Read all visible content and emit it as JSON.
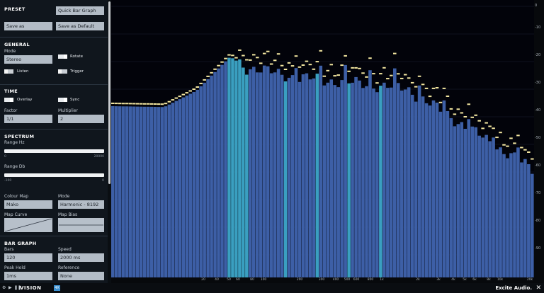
{
  "preset": {
    "title": "PRESET",
    "selected": "Quick Bar Graph",
    "save_as": "Save as",
    "save_default": "Save as Default"
  },
  "general": {
    "title": "GENERAL",
    "mode_label": "Mode",
    "mode_value": "Stereo",
    "rotate": "Rotate",
    "listen": "Listen",
    "trigger": "Trigger"
  },
  "time": {
    "title": "TIME",
    "overlay": "Overlay",
    "sync": "Sync",
    "factor_label": "Factor",
    "factor_value": "1/1",
    "multiplier_label": "Multiplier",
    "multiplier_value": "2"
  },
  "spectrum": {
    "title": "SPECTRUM",
    "range_hz_label": "Range Hz",
    "range_hz_min": "0",
    "range_hz_max": "20000",
    "range_db_label": "Range Db",
    "range_db_min": "-100",
    "range_db_max": "0",
    "colour_map_label": "Colour Map",
    "colour_map_value": "Mako",
    "mode_label": "Mode",
    "mode_value": "Harmonic - 8192",
    "map_curve_label": "Map Curve",
    "map_bias_label": "Map Bias"
  },
  "bar_graph": {
    "title": "BAR GRAPH",
    "bars_label": "Bars",
    "bars_value": "120",
    "speed_label": "Speed",
    "speed_value": "2000 ms",
    "peak_hold_label": "Peak Hold",
    "peak_hold_value": "1ms",
    "reference_label": "Reference",
    "reference_value": "None"
  },
  "plot": {
    "y_ticks": [
      "0",
      "-10",
      "-20",
      "-30",
      "-40",
      "-50",
      "-60",
      "-70",
      "-80",
      "-90"
    ],
    "x_ticks": [
      "20",
      "40",
      "50",
      "60",
      "80",
      "100",
      "200",
      "300",
      "400",
      "500",
      "600",
      "800",
      "1k",
      "2k",
      "3k",
      "4k",
      "5k",
      "6k",
      "8k",
      "10k",
      "20k"
    ],
    "colors": {
      "bar": "#3d5fa6",
      "bar_highlight": "#3a9fc0",
      "peak": "#f3e6a0",
      "background": "#02030a"
    }
  },
  "footer": {
    "brand": "Excite Audio.",
    "logo": "VISION",
    "logo_badge": "4X",
    "icons": [
      "settings-icon",
      "play-icon",
      "pause-icon",
      "close-icon"
    ]
  }
}
